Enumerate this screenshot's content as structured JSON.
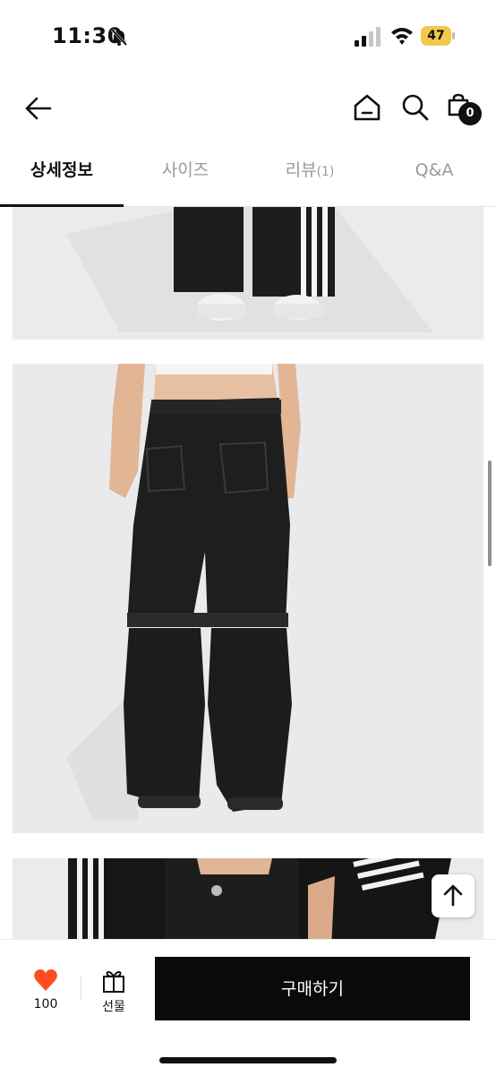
{
  "status_bar": {
    "time": "11:30",
    "battery": "47"
  },
  "header": {
    "cart_count": "0"
  },
  "tabs": [
    {
      "label": "상세정보"
    },
    {
      "label": "사이즈"
    },
    {
      "label": "리뷰",
      "count": "(1)"
    },
    {
      "label": "Q&A"
    }
  ],
  "bottom_bar": {
    "like_count": "100",
    "gift_label": "선물",
    "buy_label": "구매하기"
  },
  "colors": {
    "accent_heart": "#ff4d1f",
    "buy_button": "#0a0a0a",
    "photo_bg": "#e9e9eb"
  },
  "icons": [
    "bell-slash-icon",
    "signal-icon",
    "wifi-icon",
    "battery-icon",
    "back-arrow-icon",
    "home-icon",
    "search-icon",
    "cart-icon",
    "heart-icon",
    "gift-icon",
    "arrow-up-icon"
  ]
}
